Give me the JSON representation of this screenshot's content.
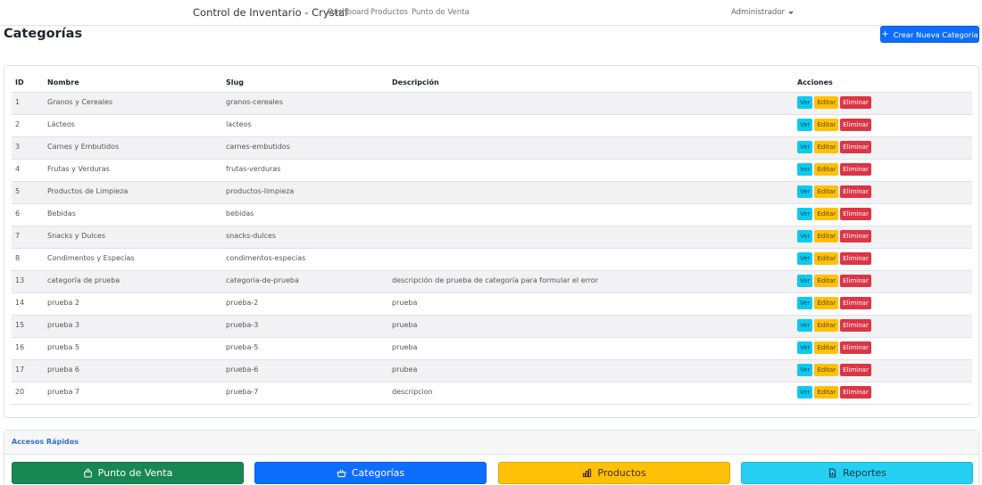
{
  "navbar": {
    "brand": "Control de Inventario - Crystal",
    "links": [
      "Dashboard",
      "Productos",
      "Punto de Venta"
    ],
    "user": "Administrador"
  },
  "page": {
    "title": "Categorías",
    "create_button": "Crear Nueva Categoría"
  },
  "table": {
    "headers": [
      "ID",
      "Nombre",
      "Slug",
      "Descripción",
      "Acciones"
    ],
    "actions": {
      "view": "Ver",
      "edit": "Editar",
      "delete": "Eliminar"
    },
    "rows": [
      {
        "id": "1",
        "nombre": "Granos y Cereales",
        "slug": "granos-cereales",
        "descripcion": ""
      },
      {
        "id": "2",
        "nombre": "Lácteos",
        "slug": "lacteos",
        "descripcion": ""
      },
      {
        "id": "3",
        "nombre": "Carnes y Embutidos",
        "slug": "carnes-embutidos",
        "descripcion": ""
      },
      {
        "id": "4",
        "nombre": "Frutas y Verduras",
        "slug": "frutas-verduras",
        "descripcion": ""
      },
      {
        "id": "5",
        "nombre": "Productos de Limpieza",
        "slug": "productos-limpieza",
        "descripcion": ""
      },
      {
        "id": "6",
        "nombre": "Bebidas",
        "slug": "bebidas",
        "descripcion": ""
      },
      {
        "id": "7",
        "nombre": "Snacks y Dulces",
        "slug": "snacks-dulces",
        "descripcion": ""
      },
      {
        "id": "8",
        "nombre": "Condimentos y Especias",
        "slug": "condimentos-especias",
        "descripcion": ""
      },
      {
        "id": "13",
        "nombre": "categoría de prueba",
        "slug": "categoria-de-prueba",
        "descripcion": "descripción de prueba de categoría para formular el error"
      },
      {
        "id": "14",
        "nombre": "prueba 2",
        "slug": "prueba-2",
        "descripcion": "prueba"
      },
      {
        "id": "15",
        "nombre": "prueba 3",
        "slug": "prueba-3",
        "descripcion": "prueba"
      },
      {
        "id": "16",
        "nombre": "prueba 5",
        "slug": "prueba-5",
        "descripcion": "prueba"
      },
      {
        "id": "17",
        "nombre": "prueba 6",
        "slug": "prueba-6",
        "descripcion": "prubea"
      },
      {
        "id": "20",
        "nombre": "prueba 7",
        "slug": "prueba-7",
        "descripcion": "descripcion"
      }
    ]
  },
  "quick_access": {
    "title": "Accesos Rápidos",
    "buttons": [
      {
        "label": "Punto de Venta",
        "icon": "bag-icon"
      },
      {
        "label": "Categorías",
        "icon": "basket-icon"
      },
      {
        "label": "Productos",
        "icon": "bar-chart-icon"
      },
      {
        "label": "Reportes",
        "icon": "report-icon"
      }
    ]
  },
  "colors": {
    "primary": "#0d6efd",
    "success": "#198754",
    "warning": "#ffc107",
    "info": "#0dcaf0",
    "danger": "#dc3545"
  }
}
